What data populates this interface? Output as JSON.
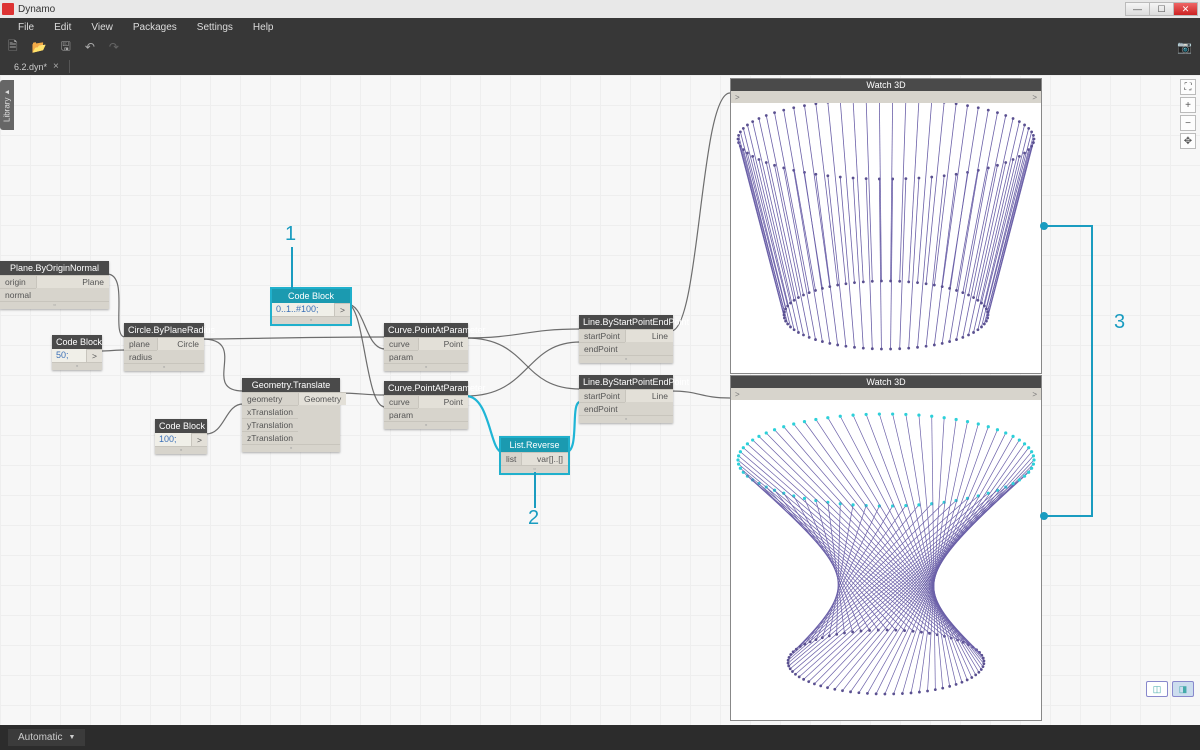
{
  "title": "Dynamo",
  "menu": [
    "File",
    "Edit",
    "View",
    "Packages",
    "Settings",
    "Help"
  ],
  "tab": "6.2.dyn*",
  "library": "Library",
  "runmode": "Automatic",
  "annotations": {
    "a1": "1",
    "a2": "2",
    "a3": "3"
  },
  "canvas_btns": [
    "⛶",
    "+",
    "−",
    "✥"
  ],
  "nodes": {
    "plane": {
      "title": "Plane.ByOriginNormal",
      "in": [
        "origin",
        "normal"
      ],
      "out": [
        "Plane"
      ]
    },
    "cb50": {
      "title": "Code Block",
      "code": "50;",
      "chev": ">"
    },
    "circle": {
      "title": "Circle.ByPlaneRadius",
      "in": [
        "plane",
        "radius"
      ],
      "out": [
        "Circle"
      ]
    },
    "cbrange": {
      "title": "Code Block",
      "code": "0..1..#100;",
      "chev": ">"
    },
    "cb100": {
      "title": "Code Block",
      "code": "100;",
      "chev": ">"
    },
    "translate": {
      "title": "Geometry.Translate",
      "in": [
        "geometry",
        "xTranslation",
        "yTranslation",
        "zTranslation"
      ],
      "out": [
        "Geometry"
      ]
    },
    "pap1": {
      "title": "Curve.PointAtParameter",
      "in": [
        "curve",
        "param"
      ],
      "out": [
        "Point"
      ]
    },
    "pap2": {
      "title": "Curve.PointAtParameter",
      "in": [
        "curve",
        "param"
      ],
      "out": [
        "Point"
      ]
    },
    "reverse": {
      "title": "List.Reverse",
      "in": [
        "list"
      ],
      "out": [
        "var[]..[]"
      ]
    },
    "line1": {
      "title": "Line.ByStartPointEndPoint",
      "in": [
        "startPoint",
        "endPoint"
      ],
      "out": [
        "Line"
      ]
    },
    "line2": {
      "title": "Line.ByStartPointEndPoint",
      "in": [
        "startPoint",
        "endPoint"
      ],
      "out": [
        "Line"
      ]
    },
    "watch1": {
      "title": "Watch 3D"
    },
    "watch2": {
      "title": "Watch 3D"
    }
  }
}
